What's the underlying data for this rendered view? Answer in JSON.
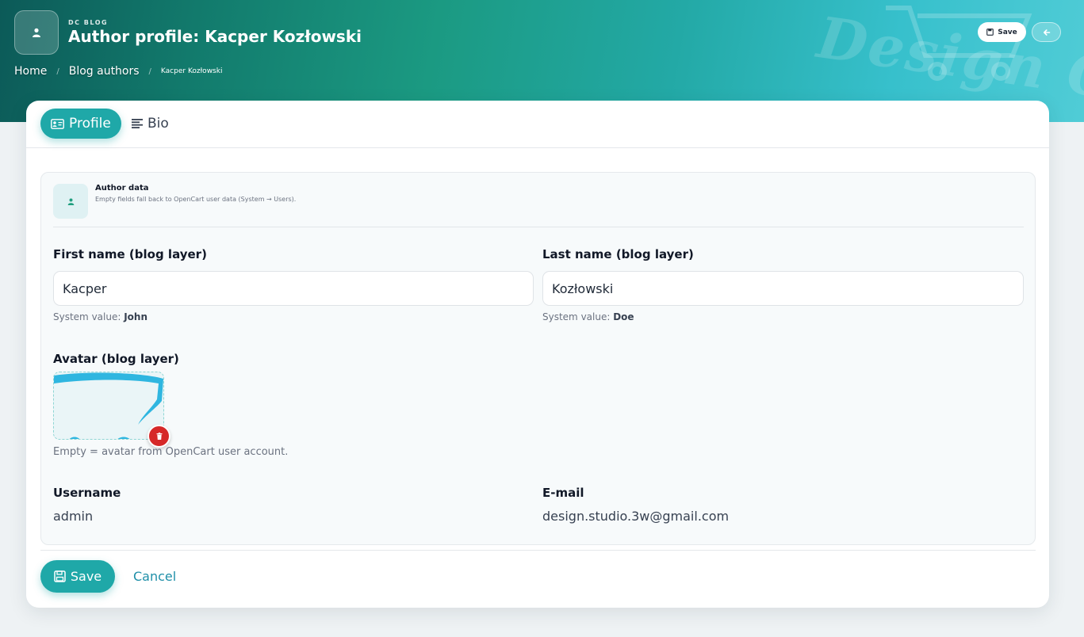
{
  "header": {
    "kicker": "DC BLOG",
    "title": "Author profile: Kacper Kozłowski",
    "save_label": "Save",
    "watermark": "Design C",
    "breadcrumb": [
      "Home",
      "Blog authors",
      "Kacper Kozłowski"
    ]
  },
  "tabs": [
    {
      "label": "Profile",
      "icon": "id-card-icon",
      "active": true
    },
    {
      "label": "Bio",
      "icon": "align-left-icon",
      "active": false
    }
  ],
  "author_panel": {
    "title": "Author data",
    "subtitle": "Empty fields fall back to OpenCart user data (System → Users)."
  },
  "form": {
    "first_name": {
      "label": "First name (blog layer)",
      "value": "Kacper",
      "help_prefix": "System value:",
      "system_value": "John"
    },
    "last_name": {
      "label": "Last name (blog layer)",
      "value": "Kozłowski",
      "help_prefix": "System value:",
      "system_value": "Doe"
    },
    "avatar": {
      "label": "Avatar (blog layer)",
      "help": "Empty = avatar from OpenCart user account."
    },
    "username": {
      "label": "Username",
      "value": "admin"
    },
    "email": {
      "label": "E-mail",
      "value": "design.studio.3w@gmail.com"
    }
  },
  "footer": {
    "save_label": "Save",
    "cancel_label": "Cancel"
  },
  "colors": {
    "accent": "#1fa8a8",
    "danger": "#d62828",
    "link": "#1f8fa8"
  }
}
